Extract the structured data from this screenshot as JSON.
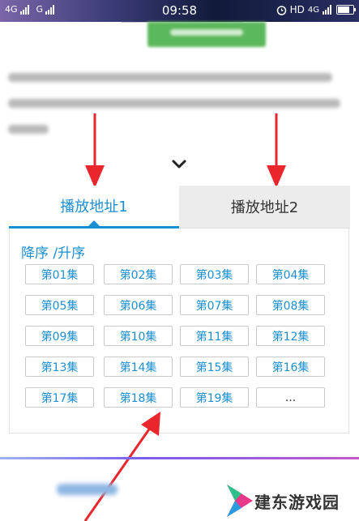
{
  "status_bar": {
    "network1": "4G",
    "network2": "G",
    "time": "09:58",
    "hd": "HD",
    "net_type": "4G"
  },
  "tabs": [
    {
      "label": "播放地址1",
      "active": true
    },
    {
      "label": "播放地址2",
      "active": false
    }
  ],
  "sort_label": "降序 /升序",
  "episodes": [
    "第01集",
    "第02集",
    "第03集",
    "第04集",
    "第05集",
    "第06集",
    "第07集",
    "第08集",
    "第09集",
    "第10集",
    "第11集",
    "第12集",
    "第13集",
    "第14集",
    "第15集",
    "第16集",
    "第17集",
    "第18集",
    "第19集",
    "..."
  ],
  "watermark": "建东游戏园",
  "colors": {
    "accent": "#1c8fd2",
    "arrow": "#e8262c",
    "tab_inactive_bg": "#ececec",
    "button_green": "#5cb85c"
  },
  "icons": {
    "expand": "chevron-down-icon",
    "alarm": "alarm-clock-icon",
    "battery": "battery-icon"
  }
}
